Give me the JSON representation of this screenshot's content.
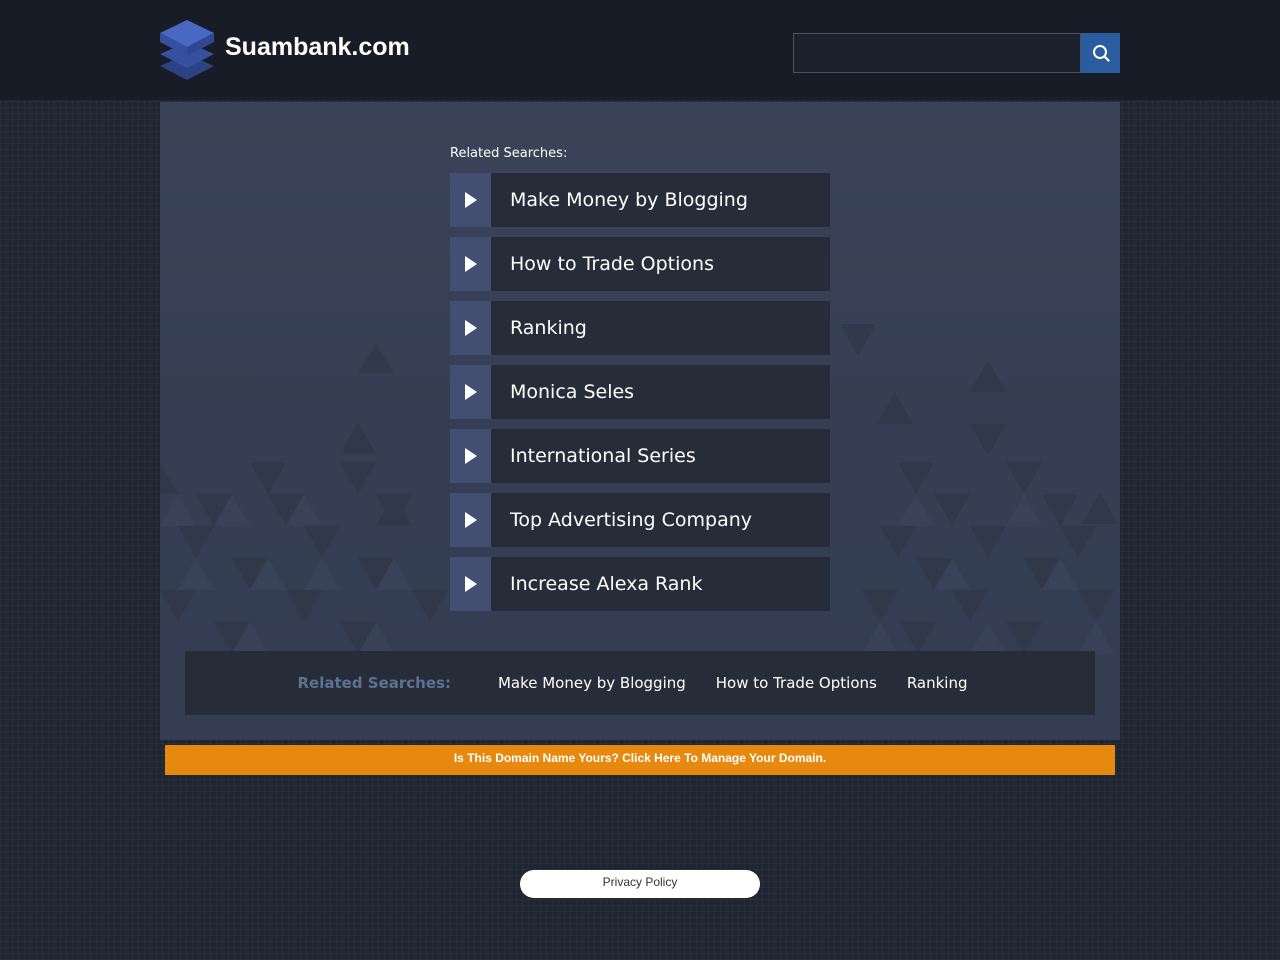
{
  "header": {
    "site_name": "Suambank.com",
    "logo_icon": "stacked-layers-icon",
    "search": {
      "placeholder": "",
      "value": "",
      "button_icon": "search-icon"
    }
  },
  "main": {
    "related_title": "Related Searches:",
    "links": [
      {
        "label": "Make Money by Blogging"
      },
      {
        "label": "How to Trade Options"
      },
      {
        "label": "Ranking"
      },
      {
        "label": "Monica Seles"
      },
      {
        "label": "International Series"
      },
      {
        "label": "Top Advertising Company"
      },
      {
        "label": "Increase Alexa Rank"
      }
    ],
    "link_arrow_icon": "play-arrow-icon"
  },
  "bottom_bar": {
    "title": "Related Searches:",
    "links": [
      {
        "label": "Make Money by Blogging"
      },
      {
        "label": "How to Trade Options"
      },
      {
        "label": "Ranking"
      }
    ]
  },
  "banner": {
    "text": "Is This Domain Name Yours? Click Here To Manage Your Domain."
  },
  "footer": {
    "privacy_label": "Privacy Policy"
  },
  "colors": {
    "header_bg": "#171c27",
    "page_bg": "#1f2531",
    "content_bg": "#3a4357",
    "accent_blue": "#2a5d9f",
    "arrow_box": "#434e72",
    "link_bg": "#262c38",
    "banner_orange": "#e8890f",
    "bottom_title": "#5d7191"
  }
}
